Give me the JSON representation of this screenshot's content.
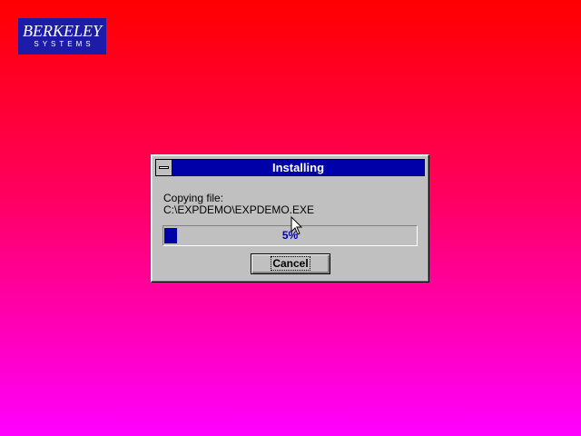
{
  "logo": {
    "line1": "BERKELEY",
    "line2": "SYSTEMS"
  },
  "dialog": {
    "title": "Installing",
    "copying_label": "Copying file:",
    "file_path": "C:\\EXPDEMO\\EXPDEMO.EXE",
    "progress": {
      "percent": 5,
      "label": "5%"
    },
    "cancel_label": "Cancel"
  },
  "icons": {
    "system_menu": "system-menu-icon",
    "cursor": "arrow-cursor-icon"
  },
  "colors": {
    "background_top": "#ff0000",
    "background_bottom": "#ff00ff",
    "titlebar": "#0000a8",
    "dialog_face": "#c0c0c0",
    "progress_fill": "#0000a8",
    "logo_bg": "#1c1ca8"
  }
}
